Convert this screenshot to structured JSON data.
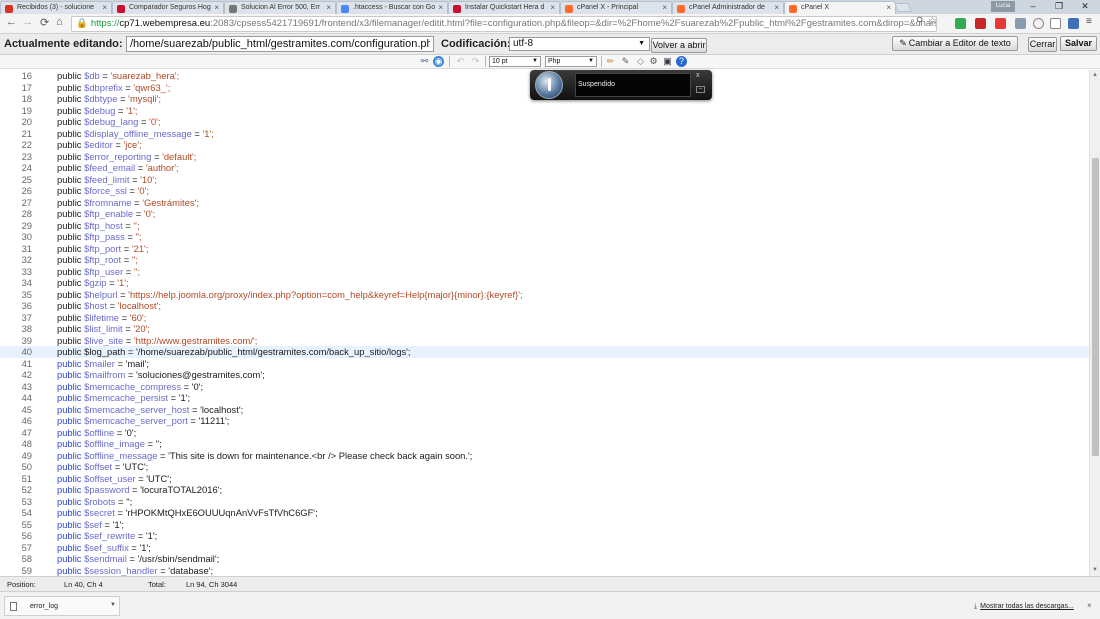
{
  "browser": {
    "tabs": [
      {
        "title": "Recibidos (3) - solucione",
        "favicon_color": "#d93025",
        "active": false
      },
      {
        "title": "Comparador Seguros Hog",
        "favicon_color": "#c8102e",
        "active": false
      },
      {
        "title": "Solucion Al Error 500, Err",
        "favicon_color": "#777777",
        "active": false
      },
      {
        "title": ".htaccess - Buscar con Go",
        "favicon_color": "#4a88f5",
        "active": false
      },
      {
        "title": "Instalar Quickstart Hera d",
        "favicon_color": "#c8102e",
        "active": false
      },
      {
        "title": "cPanel X - Principal",
        "favicon_color": "#ff6c2c",
        "active": false
      },
      {
        "title": "cPanel Administrador de",
        "favicon_color": "#ff6c2c",
        "active": false
      },
      {
        "title": "cPanel X",
        "favicon_color": "#ff6c2c",
        "active": true
      }
    ],
    "tab_close_symbol": "×",
    "user_badge": "Lucia",
    "url": {
      "protocol": "https://",
      "host": "cp71.webempresa.eu",
      "path": ":2083/cpsess5421719691/frontend/x3/filemanager/editit.html?file=configuration.php&fileop=&dir=%2Fhome%2Fsuarezab%2Fpublic_html%2Fgestramites.com&dirop=&charse"
    },
    "window_controls": [
      "–",
      "❐",
      "✕"
    ],
    "toolbar_icons": [
      "search-icon",
      "star-icon",
      "drive-icon",
      "pdf-icon",
      "youtube-icon",
      "dropbox-icon",
      "circle-icon",
      "mail-icon",
      "shield-icon",
      "menu-icon"
    ]
  },
  "editor_header": {
    "editing_label": "Actualmente editando:",
    "file_path": "/home/suarezab/public_html/gestramites.com/configuration.php",
    "encoding_label": "Codificación:",
    "encoding_value": "utf-8",
    "reopen_button": "Volver a abrir",
    "switch_editor_button": "Cambiar a Editor de texto",
    "close_button": "Cerrar",
    "save_button": "Salvar"
  },
  "edit_toolbar": {
    "font_size": "10 pt",
    "language": "Php"
  },
  "media_popup": {
    "status": "Suspendido",
    "close_symbol": "x"
  },
  "code": {
    "current_line": 40,
    "lines": [
      {
        "n": "16",
        "kw": "public",
        "var": "$db",
        "val": "'suarezab_hera';"
      },
      {
        "n": "17",
        "kw": "public",
        "var": "$dbprefix",
        "val": "'qwr63_';"
      },
      {
        "n": "18",
        "kw": "public",
        "var": "$dbtype",
        "val": "'mysqli';"
      },
      {
        "n": "19",
        "kw": "public",
        "var": "$debug",
        "val": "'1';"
      },
      {
        "n": "20",
        "kw": "public",
        "var": "$debug_lang",
        "val": "'0';"
      },
      {
        "n": "21",
        "kw": "public",
        "var": "$display_offline_message",
        "val": "'1';"
      },
      {
        "n": "22",
        "kw": "public",
        "var": "$editor",
        "val": "'jce';"
      },
      {
        "n": "23",
        "kw": "public",
        "var": "$error_reporting",
        "val": "'default';"
      },
      {
        "n": "24",
        "kw": "public",
        "var": "$feed_email",
        "val": "'author';"
      },
      {
        "n": "25",
        "kw": "public",
        "var": "$feed_limit",
        "val": "'10';"
      },
      {
        "n": "26",
        "kw": "public",
        "var": "$force_ssl",
        "val": "'0';"
      },
      {
        "n": "27",
        "kw": "public",
        "var": "$fromname",
        "val": "'Gestrámites';"
      },
      {
        "n": "28",
        "kw": "public",
        "var": "$ftp_enable",
        "val": "'0';"
      },
      {
        "n": "29",
        "kw": "public",
        "var": "$ftp_host",
        "val": "'';"
      },
      {
        "n": "30",
        "kw": "public",
        "var": "$ftp_pass",
        "val": "'';"
      },
      {
        "n": "31",
        "kw": "public",
        "var": "$ftp_port",
        "val": "'21';"
      },
      {
        "n": "32",
        "kw": "public",
        "var": "$ftp_root",
        "val": "'';"
      },
      {
        "n": "33",
        "kw": "public",
        "var": "$ftp_user",
        "val": "'';"
      },
      {
        "n": "34",
        "kw": "public",
        "var": "$gzip",
        "val": "'1';"
      },
      {
        "n": "35",
        "kw": "public",
        "var": "$helpurl",
        "val": "'https://help.joomla.org/proxy/index.php?option=com_help&keyref=Help{major}{minor}:{keyref}';"
      },
      {
        "n": "36",
        "kw": "public",
        "var": "$host",
        "val": "'localhost';"
      },
      {
        "n": "37",
        "kw": "public",
        "var": "$lifetime",
        "val": "'60';"
      },
      {
        "n": "38",
        "kw": "public",
        "var": "$list_limit",
        "val": "'20';"
      },
      {
        "n": "39",
        "kw": "public",
        "var": "$live_site",
        "val": "'http://www.gestramites.com/';"
      },
      {
        "n": "40",
        "kw": "public",
        "var": "$log_path",
        "val": "'/home/suarezab/public_html/gestramites.com/back_up_sitio/logs';"
      },
      {
        "n": "41",
        "kw": "public",
        "var": "$mailer",
        "val": "'mail';"
      },
      {
        "n": "42",
        "kw": "public",
        "var": "$mailfrom",
        "val": "'soluciones@gestramites.com';"
      },
      {
        "n": "43",
        "kw": "public",
        "var": "$memcache_compress",
        "val": "'0';"
      },
      {
        "n": "44",
        "kw": "public",
        "var": "$memcache_persist",
        "val": "'1';"
      },
      {
        "n": "45",
        "kw": "public",
        "var": "$memcache_server_host",
        "val": "'localhost';"
      },
      {
        "n": "46",
        "kw": "public",
        "var": "$memcache_server_port",
        "val": "'11211';"
      },
      {
        "n": "47",
        "kw": "public",
        "var": "$offline",
        "val": "'0';"
      },
      {
        "n": "48",
        "kw": "public",
        "var": "$offline_image",
        "val": "'';"
      },
      {
        "n": "49",
        "kw": "public",
        "var": "$offline_message",
        "val": "'This site is down for maintenance.<br /> Please check back again soon.';"
      },
      {
        "n": "50",
        "kw": "public",
        "var": "$offset",
        "val": "'UTC';"
      },
      {
        "n": "51",
        "kw": "public",
        "var": "$offset_user",
        "val": "'UTC';"
      },
      {
        "n": "52",
        "kw": "public",
        "var": "$password",
        "val": "'locuraTOTAL2016';"
      },
      {
        "n": "53",
        "kw": "public",
        "var": "$robots",
        "val": "'';"
      },
      {
        "n": "54",
        "kw": "public",
        "var": "$secret",
        "val": "'rHPOKMtQHxE6OUUUqnAnVvFsTfVhC6GF';"
      },
      {
        "n": "55",
        "kw": "public",
        "var": "$sef",
        "val": "'1';"
      },
      {
        "n": "56",
        "kw": "public",
        "var": "$sef_rewrite",
        "val": "'1';"
      },
      {
        "n": "57",
        "kw": "public",
        "var": "$sef_suffix",
        "val": "'1';"
      },
      {
        "n": "58",
        "kw": "public",
        "var": "$sendmail",
        "val": "'/usr/sbin/sendmail';"
      },
      {
        "n": "59",
        "kw": "public",
        "var": "$session_handler",
        "val": "'database';"
      }
    ]
  },
  "status_bar": {
    "position_label": "Position:",
    "position_value": "Ln 40, Ch 4",
    "total_label": "Total:",
    "total_value": "Ln 94, Ch 3044"
  },
  "download_shelf": {
    "file_name": "error_log",
    "show_all": "Mostrar todas las descargas...",
    "close_symbol": "×"
  }
}
